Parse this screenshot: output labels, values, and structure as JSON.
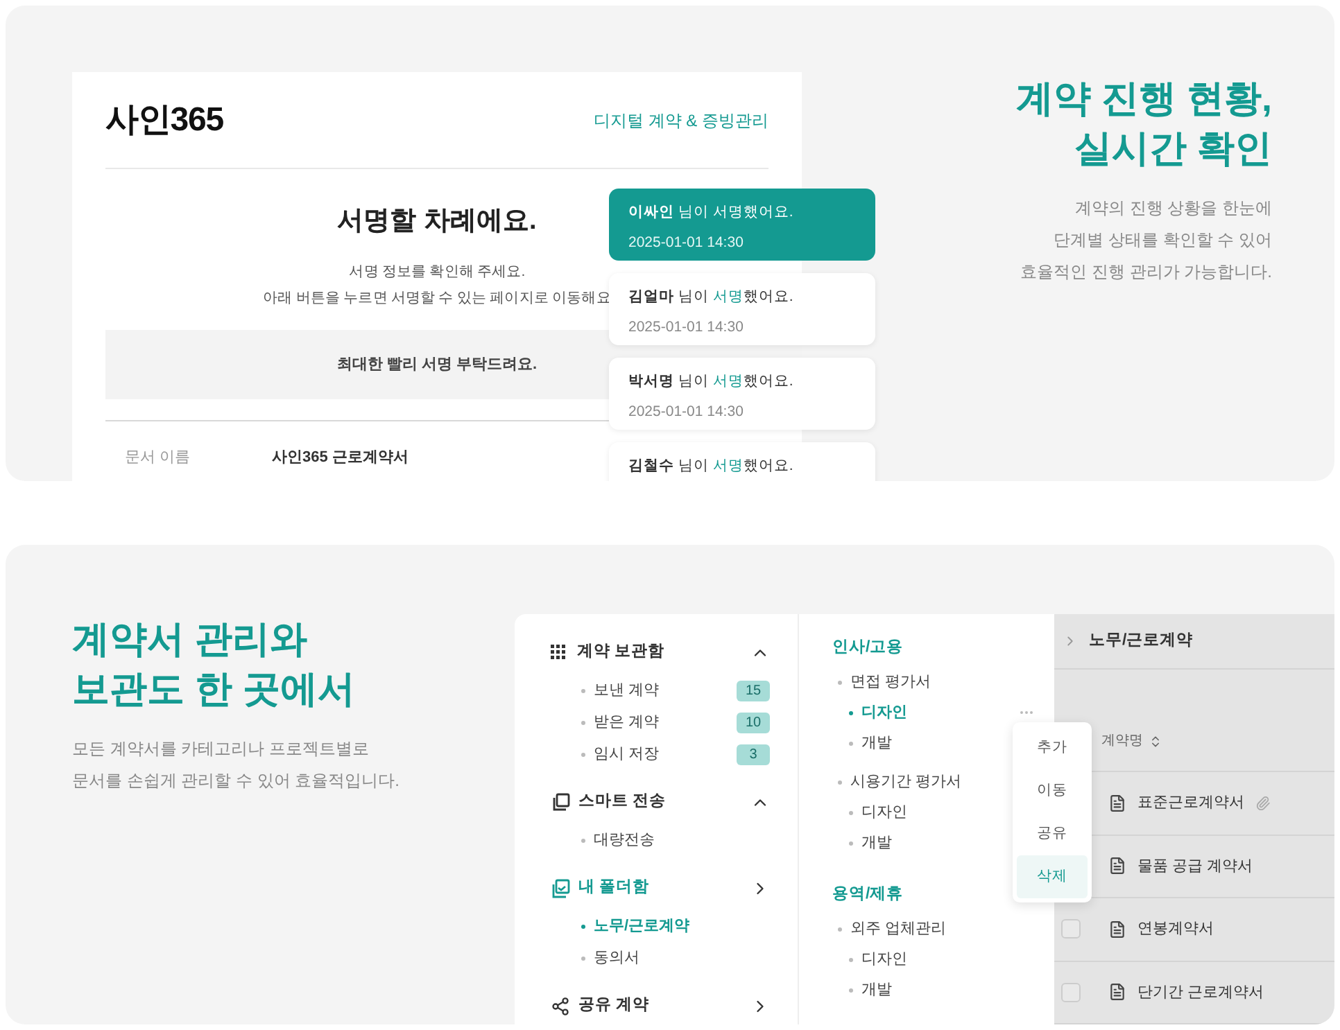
{
  "signing_preview": {
    "logo": "사인365",
    "tagline": "디지털 계약 & 증빙관리",
    "title": "서명할 차례에요.",
    "subtitle_lines": [
      "서명 정보를 확인해 주세요.",
      "아래 버튼을 누르면 서명할 수 있는 페이지로 이동해요"
    ],
    "notice": "최대한 빨리 서명 부탁드려요.",
    "field_label": "문서 이름",
    "field_value": "사인365 근로계약서"
  },
  "notifications": [
    {
      "name": "이싸인",
      "pre": " 님이 ",
      "verb": "서명",
      "post": "했어요.",
      "time": "2025-01-01 14:30",
      "selected": true
    },
    {
      "name": "김얼마",
      "pre": " 님이 ",
      "verb": "서명",
      "post": "했어요.",
      "time": "2025-01-01 14:30",
      "selected": false
    },
    {
      "name": "박서명",
      "pre": " 님이 ",
      "verb": "서명",
      "post": "했어요.",
      "time": "2025-01-01 14:30",
      "selected": false
    },
    {
      "name": "김철수",
      "pre": " 님이 ",
      "verb": "서명",
      "post": "했어요.",
      "selected": false
    }
  ],
  "feature_1": {
    "heading_lines": [
      "계약 진행 현황,",
      "실시간 확인"
    ],
    "body_lines": [
      "계약의 진행 상황을 한눈에",
      "단계별 상태를 확인할 수 있어",
      "효율적인 진행 관리가 가능합니다."
    ]
  },
  "feature_2": {
    "heading_lines": [
      "계약서 관리와",
      "보관도 한 곳에서"
    ],
    "body_lines": [
      "모든 계약서를 카테고리나 프로젝트별로",
      "문서를 손쉽게 관리할 수 있어 효율적입니다."
    ]
  },
  "sidebar": [
    {
      "kind": "grid",
      "label": "계약 보관함",
      "active": false,
      "expanded": true,
      "items": [
        {
          "label": "보낸 계약",
          "count": "15",
          "selected": false
        },
        {
          "label": "받은 계약",
          "count": "10",
          "selected": false
        },
        {
          "label": "임시 저장",
          "count": "3",
          "selected": false
        }
      ]
    },
    {
      "kind": "copies",
      "label": "스마트 전송",
      "active": false,
      "expanded": true,
      "items": [
        {
          "label": "대량전송",
          "selected": false
        }
      ]
    },
    {
      "kind": "folder",
      "label": "내 폴더함",
      "active": true,
      "expanded": false,
      "items": [
        {
          "label": "노무/근로계약",
          "selected": true
        },
        {
          "label": "동의서",
          "selected": false
        }
      ]
    },
    {
      "kind": "share",
      "label": "공유 계약",
      "active": false,
      "expanded": false
    }
  ],
  "folders": [
    {
      "label": "인사/고용",
      "children": [
        {
          "label": "면접 평가서",
          "selected": false,
          "children": [
            {
              "label": "디자인",
              "selected": true
            },
            {
              "label": "개발",
              "selected": false
            }
          ]
        },
        {
          "label": "시용기간 평가서",
          "selected": false,
          "children": [
            {
              "label": "디자인",
              "selected": false
            },
            {
              "label": "개발",
              "selected": false
            }
          ]
        }
      ]
    },
    {
      "label": "용역/제휴",
      "children": [
        {
          "label": "외주 업체관리",
          "selected": false,
          "children": [
            {
              "label": "디자인",
              "selected": false
            },
            {
              "label": "개발",
              "selected": false
            }
          ]
        }
      ]
    }
  ],
  "context_menu": [
    {
      "label": "추가",
      "selected": false
    },
    {
      "label": "이동",
      "selected": false
    },
    {
      "label": "공유",
      "selected": false
    },
    {
      "label": "삭제",
      "selected": true
    }
  ],
  "contracts": {
    "breadcrumb": "노무/근로계약",
    "column": "계약명",
    "rows": [
      {
        "name": "표준근로계약서",
        "attachment": true
      },
      {
        "name": "물품 공급 계약서",
        "attachment": false
      },
      {
        "name": "연봉계약서",
        "attachment": false,
        "checked": false
      },
      {
        "name": "단기간 근로계약서",
        "attachment": false,
        "checked": false
      }
    ]
  }
}
